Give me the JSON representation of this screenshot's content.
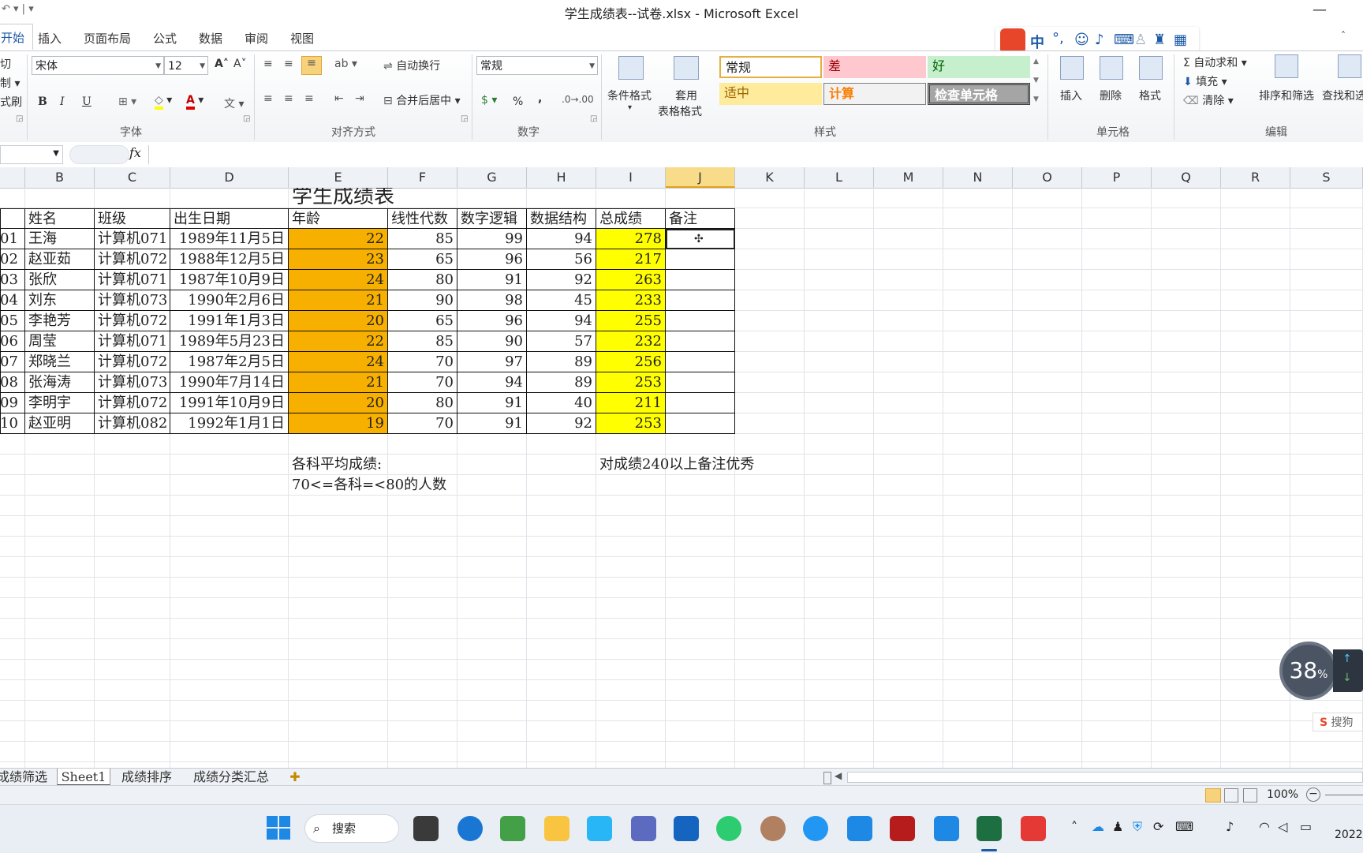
{
  "window": {
    "title": "学生成绩表--试卷.xlsx - Microsoft Excel",
    "quick_access": "↶ ▾ | ▾",
    "minimize": "—",
    "close": "✕"
  },
  "ribbon_tabs": [
    "开始",
    "插入",
    "页面布局",
    "公式",
    "数据",
    "审阅",
    "视图"
  ],
  "ribbon": {
    "clipboard": {
      "cut": "切",
      "copy": "制 ▾",
      "painter": "式刷"
    },
    "font": {
      "name": "宋体",
      "size": "12",
      "grow": "A˄",
      "shrink": "A˅",
      "bold": "B",
      "italic": "I",
      "underline": "U",
      "label": "字体"
    },
    "alignment": {
      "wrap": "自动换行",
      "merge": "合并后居中",
      "label": "对齐方式"
    },
    "number": {
      "format": "常规",
      "percent": "%",
      "comma": ",",
      "label": "数字"
    },
    "styles": {
      "conditional": "条件格式",
      "table_line1": "套用",
      "table_line2": "表格格式",
      "normal": "常规",
      "bad": "差",
      "good": "好",
      "neutral": "适中",
      "calc": "计算",
      "check": "检查单元格",
      "label": "样式"
    },
    "cells": {
      "insert": "插入",
      "delete": "删除",
      "format": "格式",
      "label": "单元格"
    },
    "editing": {
      "autosum": "Σ 自动求和 ▾",
      "fill": "填充 ▾",
      "clear": "清除 ▾",
      "sort": "排序和筛选",
      "find": "查找和选",
      "label": "编辑"
    }
  },
  "formula_bar": {
    "fx": "fx",
    "value": ""
  },
  "columns": [
    "B",
    "C",
    "D",
    "E",
    "F",
    "G",
    "H",
    "I",
    "J",
    "K",
    "L",
    "M",
    "N",
    "O",
    "P",
    "Q",
    "R",
    "S"
  ],
  "selected_column": "J",
  "sheet": {
    "title": "学生成绩表",
    "headers": [
      "姓名",
      "班级",
      "出生日期",
      "年龄",
      "线性代数",
      "数字逻辑",
      "数据结构",
      "总成绩",
      "备注"
    ],
    "rows": [
      {
        "id": "01",
        "name": "王海",
        "cls": "计算机071",
        "dob": "1989年11月5日",
        "age": "22",
        "la": "85",
        "dl": "99",
        "ds": "94",
        "total": "278"
      },
      {
        "id": "02",
        "name": "赵亚茹",
        "cls": "计算机072",
        "dob": "1988年12月5日",
        "age": "23",
        "la": "65",
        "dl": "96",
        "ds": "56",
        "total": "217"
      },
      {
        "id": "03",
        "name": "张欣",
        "cls": "计算机071",
        "dob": "1987年10月9日",
        "age": "24",
        "la": "80",
        "dl": "91",
        "ds": "92",
        "total": "263"
      },
      {
        "id": "04",
        "name": "刘东",
        "cls": "计算机073",
        "dob": "1990年2月6日",
        "age": "21",
        "la": "90",
        "dl": "98",
        "ds": "45",
        "total": "233"
      },
      {
        "id": "05",
        "name": "李艳芳",
        "cls": "计算机072",
        "dob": "1991年1月3日",
        "age": "20",
        "la": "65",
        "dl": "96",
        "ds": "94",
        "total": "255"
      },
      {
        "id": "06",
        "name": "周莹",
        "cls": "计算机071",
        "dob": "1989年5月23日",
        "age": "22",
        "la": "85",
        "dl": "90",
        "ds": "57",
        "total": "232"
      },
      {
        "id": "07",
        "name": "郑晓兰",
        "cls": "计算机072",
        "dob": "1987年2月5日",
        "age": "24",
        "la": "70",
        "dl": "97",
        "ds": "89",
        "total": "256"
      },
      {
        "id": "08",
        "name": "张海涛",
        "cls": "计算机073",
        "dob": "1990年7月14日",
        "age": "21",
        "la": "70",
        "dl": "94",
        "ds": "89",
        "total": "253"
      },
      {
        "id": "09",
        "name": "李明宇",
        "cls": "计算机072",
        "dob": "1991年10月9日",
        "age": "20",
        "la": "80",
        "dl": "91",
        "ds": "40",
        "total": "211"
      },
      {
        "id": "10",
        "name": "赵亚明",
        "cls": "计算机082",
        "dob": "1992年1月1日",
        "age": "19",
        "la": "70",
        "dl": "91",
        "ds": "92",
        "total": "253"
      }
    ],
    "avg_label": "各科平均成绩:",
    "count_label": "70<=各科=<80的人数",
    "note": "对成绩240以上备注优秀"
  },
  "sheet_tabs": [
    "成绩筛选",
    "Sheet1",
    "成绩排序",
    "成绩分类汇总"
  ],
  "active_sheet": "Sheet1",
  "status": {
    "zoom": "100%"
  },
  "taskbar": {
    "search": "搜索",
    "clock": "2022/"
  },
  "overlays": {
    "perf": "38",
    "perf_unit": "%",
    "sogou": "搜狗"
  },
  "colors": {
    "age_fill": "#f7b000",
    "total_fill": "#ffff00",
    "accent": "#1d5aa6"
  }
}
